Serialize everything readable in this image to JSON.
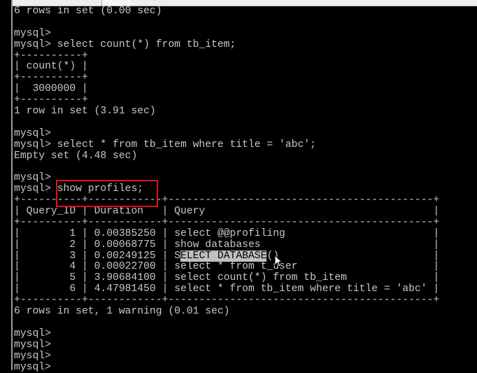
{
  "terminal": {
    "lines_before_table": [
      "6 rows in set (0.00 sec)",
      "",
      "mysql>",
      "mysql> select count(*) from tb_item;",
      "+----------+",
      "| count(*) |",
      "+----------+",
      "|  3000000 |",
      "+----------+",
      "1 row in set (3.91 sec)",
      "",
      "mysql>",
      "mysql> select * from tb_item where title = 'abc';",
      "Empty set (4.48 sec)",
      "",
      "mysql>"
    ],
    "prompt": "mysql> ",
    "command": "show profiles;",
    "profiles_table": {
      "border": "+----------+------------+-------------------------------------------+",
      "header": "| Query_ID | Duration   | Query                                     |",
      "rows": [
        {
          "id": "1",
          "duration": "0.00385250",
          "query": "select @@profiling"
        },
        {
          "id": "2",
          "duration": "0.00068775",
          "query": "show databases"
        },
        {
          "id": "3",
          "duration": "0.00249125",
          "query_pre": "S",
          "query_highlight": "ELECT DATABASE",
          "query_post": "()"
        },
        {
          "id": "4",
          "duration": "0.00022700",
          "query": "select * from t_user"
        },
        {
          "id": "5",
          "duration": "3.90684100",
          "query": "select count(*) from tb_item"
        },
        {
          "id": "6",
          "duration": "4.47981450",
          "query": "select * from tb_item where title = 'abc'"
        }
      ]
    },
    "lines_after_table": [
      "6 rows in set, 1 warning (0.01 sec)",
      "",
      "mysql>",
      "mysql>",
      "mysql>",
      "mysql>"
    ]
  },
  "colors": {
    "text": "#c8c8c8",
    "background": "#000000",
    "annotation_box": "#e01020",
    "selection": "#c0c0c0"
  }
}
